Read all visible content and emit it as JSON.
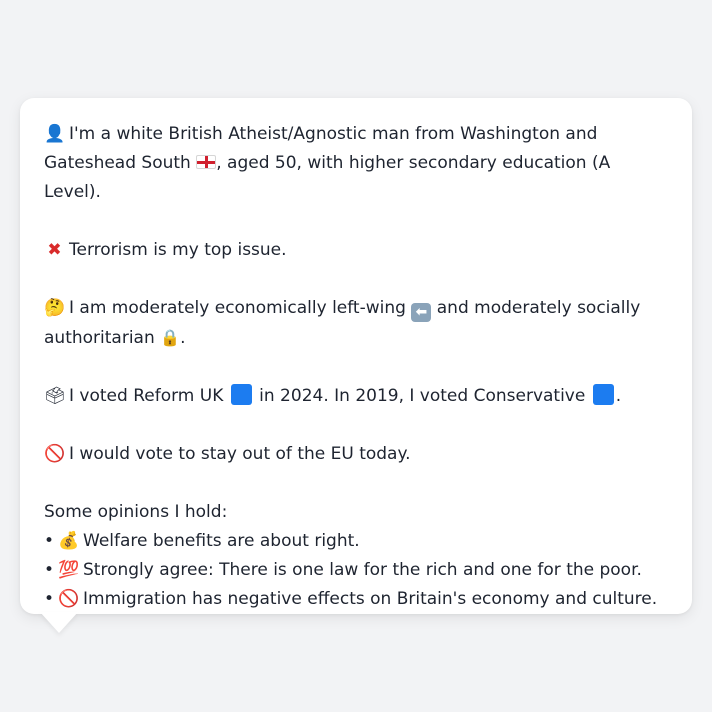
{
  "profile": {
    "intro_emoji": "👤",
    "intro_text_a": "I'm a white British Atheist/Agnostic man from Washington and Gateshead South",
    "intro_text_b": ", aged 50, with higher secondary education (A Level).",
    "region_flag_icon": "england-flag-icon",
    "top_issue_emoji": "✖",
    "top_issue_text": "Terrorism is my top issue.",
    "stance_emoji": "🤔",
    "stance_text_a": "I am moderately economically left-wing",
    "stance_arrow": "⬅",
    "stance_text_b": "and moderately socially",
    "stance_text_c": "authoritarian",
    "stance_lock": "🔒",
    "stance_text_d": ".",
    "vote_emoji": "🗳",
    "vote_text_a": "I voted Reform UK",
    "vote_text_b": "in 2024. In 2019, I voted Conservative",
    "vote_text_c": ".",
    "eu_emoji": "🚫",
    "eu_text": "I would vote to stay out of the EU today.",
    "opinions_heading": "Some opinions I hold:",
    "opinions": [
      {
        "bullet": "•",
        "emoji": "💰",
        "text": "Welfare benefits are about right."
      },
      {
        "bullet": "•",
        "emoji": "💯",
        "text": "Strongly agree: There is one law for the rich and one for the poor."
      },
      {
        "bullet": "•",
        "emoji": "🚫",
        "text": "Immigration has negative effects on Britain's economy and culture."
      }
    ]
  },
  "colors": {
    "background": "#f2f3f5",
    "bubble": "#ffffff",
    "text": "#1e2430",
    "reform_blue": "#1c7cf0",
    "conservative_blue": "#1c7cf0"
  }
}
